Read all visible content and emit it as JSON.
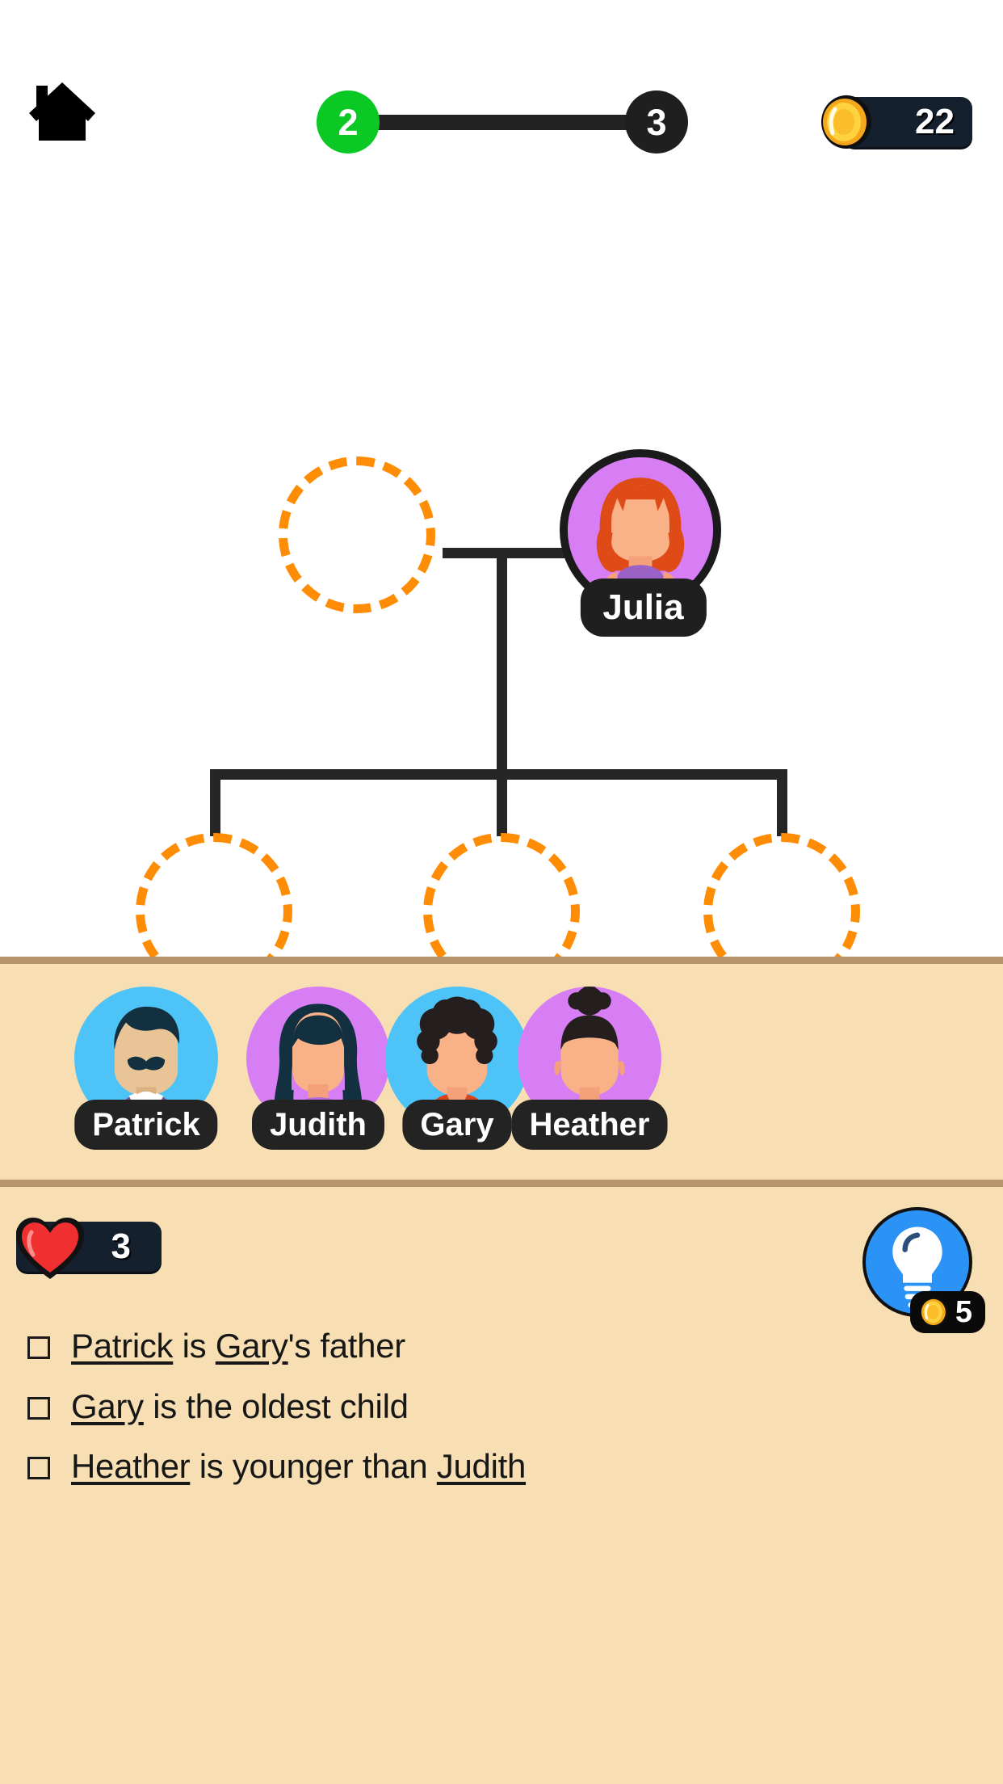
{
  "header": {
    "home_icon": "home-icon",
    "progress": {
      "current_level": "2",
      "next_level": "3"
    },
    "coins": {
      "icon": "coin-icon",
      "amount": "22"
    }
  },
  "tree": {
    "nodes": [
      {
        "id": "parent-left",
        "type": "empty",
        "name": "",
        "label": "",
        "row": "parents"
      },
      {
        "id": "parent-right",
        "type": "filled",
        "name": "Julia",
        "label": "Julia",
        "row": "parents",
        "colors": {
          "bg": "#d77ef5",
          "hair": "#df4b17",
          "skin": "#f9b188",
          "shirt": "#9a62c4"
        }
      },
      {
        "id": "child-1",
        "type": "empty",
        "name": "",
        "label": "",
        "row": "children"
      },
      {
        "id": "child-2",
        "type": "empty",
        "name": "",
        "label": "",
        "row": "children"
      },
      {
        "id": "child-3",
        "type": "empty",
        "name": "",
        "label": "",
        "row": "children"
      }
    ],
    "empty_slot_color": "#FF8C05",
    "connector_color": "#262626"
  },
  "tray": {
    "characters": [
      {
        "label": "Patrick",
        "colors": {
          "bg": "#4ec3f7",
          "hair": "#12303f",
          "skin": "#e8c497",
          "shirt": "#7f5090"
        }
      },
      {
        "label": "Judith",
        "colors": {
          "bg": "#d77ef5",
          "hair": "#12303f",
          "skin": "#f9b188",
          "shirt": "#b66ae0"
        }
      },
      {
        "label": "Gary",
        "colors": {
          "bg": "#4ec3f7",
          "hair": "#241f1e",
          "skin": "#f9b188",
          "shirt": "#d8441a"
        }
      },
      {
        "label": "Heather",
        "colors": {
          "bg": "#d77ef5",
          "hair": "#241f1e",
          "skin": "#f9b188",
          "shirt": "#aadcef"
        }
      }
    ]
  },
  "bottom": {
    "lives": {
      "icon": "heart-icon",
      "count": "3"
    },
    "hint": {
      "icon": "lightbulb-icon",
      "coin_icon": "coin-icon",
      "cost": "5"
    },
    "clues": [
      {
        "checked": false,
        "parts": [
          {
            "text": "Patrick",
            "name": true
          },
          {
            "text": " is ",
            "name": false
          },
          {
            "text": "Gary",
            "name": true
          },
          {
            "text": "'s father",
            "name": false
          }
        ]
      },
      {
        "checked": false,
        "parts": [
          {
            "text": "Gary",
            "name": true
          },
          {
            "text": " is the oldest child",
            "name": false
          }
        ]
      },
      {
        "checked": false,
        "parts": [
          {
            "text": "Heather",
            "name": true
          },
          {
            "text": " is younger than ",
            "name": false
          },
          {
            "text": "Judith",
            "name": true
          }
        ]
      }
    ]
  },
  "colors": {
    "page_bg": "#ffffff",
    "panel_bg": "#f7dfb3",
    "panel_border": "#b7966b",
    "accent_green": "#0BC925",
    "accent_orange": "#FF8C05",
    "dark": "#1f1f1f",
    "badge_navy": "#15202e",
    "hint_blue": "#2b93f5"
  }
}
